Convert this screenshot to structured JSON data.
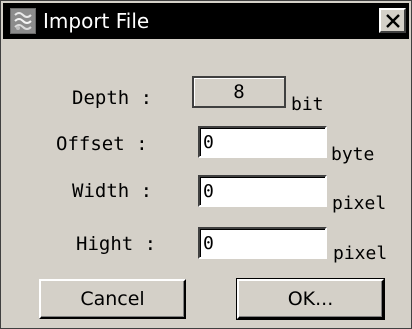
{
  "window": {
    "title": "Import File",
    "icon": "app-icon",
    "close_label": "×"
  },
  "fields": {
    "depth": {
      "label": "Depth :",
      "value": "8",
      "unit": "bit"
    },
    "offset": {
      "label": "Offset :",
      "value": "0",
      "unit": "byte"
    },
    "width": {
      "label": "Width :",
      "value": "0",
      "unit": "pixel"
    },
    "hight": {
      "label": "Hight :",
      "value": "0",
      "unit": "pixel"
    }
  },
  "buttons": {
    "cancel": "Cancel",
    "ok": "OK..."
  },
  "colors": {
    "face": "#d4d0c8",
    "titlebar": "#000000",
    "title_text": "#ffffff"
  }
}
